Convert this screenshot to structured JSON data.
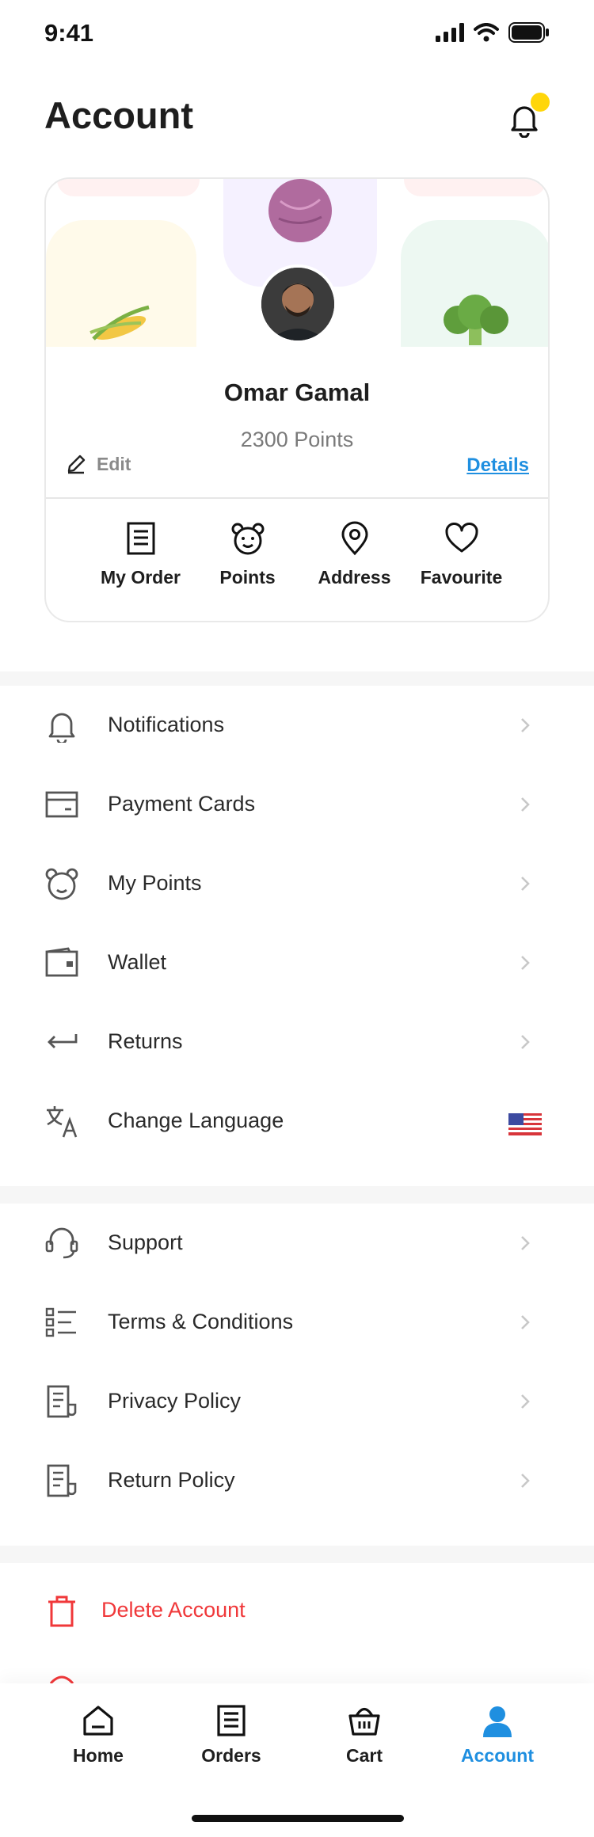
{
  "status_bar": {
    "time": "9:41"
  },
  "header": {
    "title": "Account"
  },
  "profile": {
    "name": "Omar Gamal",
    "points": "2300 Points",
    "edit_label": "Edit",
    "details_label": "Details",
    "quick_actions": [
      {
        "label": "My Order",
        "icon": "receipt-icon"
      },
      {
        "label": "Points",
        "icon": "bear-icon"
      },
      {
        "label": "Address",
        "icon": "location-pin-icon"
      },
      {
        "label": "Favourite",
        "icon": "heart-icon"
      }
    ]
  },
  "menu_primary": [
    {
      "label": "Notifications",
      "icon": "bell-icon"
    },
    {
      "label": "Payment Cards",
      "icon": "card-icon"
    },
    {
      "label": "My Points",
      "icon": "bear-icon"
    },
    {
      "label": "Wallet",
      "icon": "wallet-icon"
    },
    {
      "label": "Returns",
      "icon": "return-arrow-icon"
    },
    {
      "label": "Change Language",
      "icon": "translate-icon",
      "trailing": "us-flag-icon"
    }
  ],
  "menu_secondary": [
    {
      "label": "Support",
      "icon": "headset-icon"
    },
    {
      "label": "Terms & Conditions",
      "icon": "checklist-icon"
    },
    {
      "label": "Privacy Policy",
      "icon": "document-icon"
    },
    {
      "label": "Return Policy",
      "icon": "document-icon"
    }
  ],
  "danger": {
    "delete_label": "Delete Account",
    "icon": "trash-icon"
  },
  "tabs": [
    {
      "label": "Home",
      "icon": "home-icon",
      "active": false
    },
    {
      "label": "Orders",
      "icon": "receipt-icon",
      "active": false
    },
    {
      "label": "Cart",
      "icon": "basket-icon",
      "active": false
    },
    {
      "label": "Account",
      "icon": "user-icon",
      "active": true
    }
  ],
  "colors": {
    "accent": "#1f8fe0",
    "danger": "#f0383a",
    "badge": "#ffd60a",
    "muted": "#7a7a7a"
  }
}
